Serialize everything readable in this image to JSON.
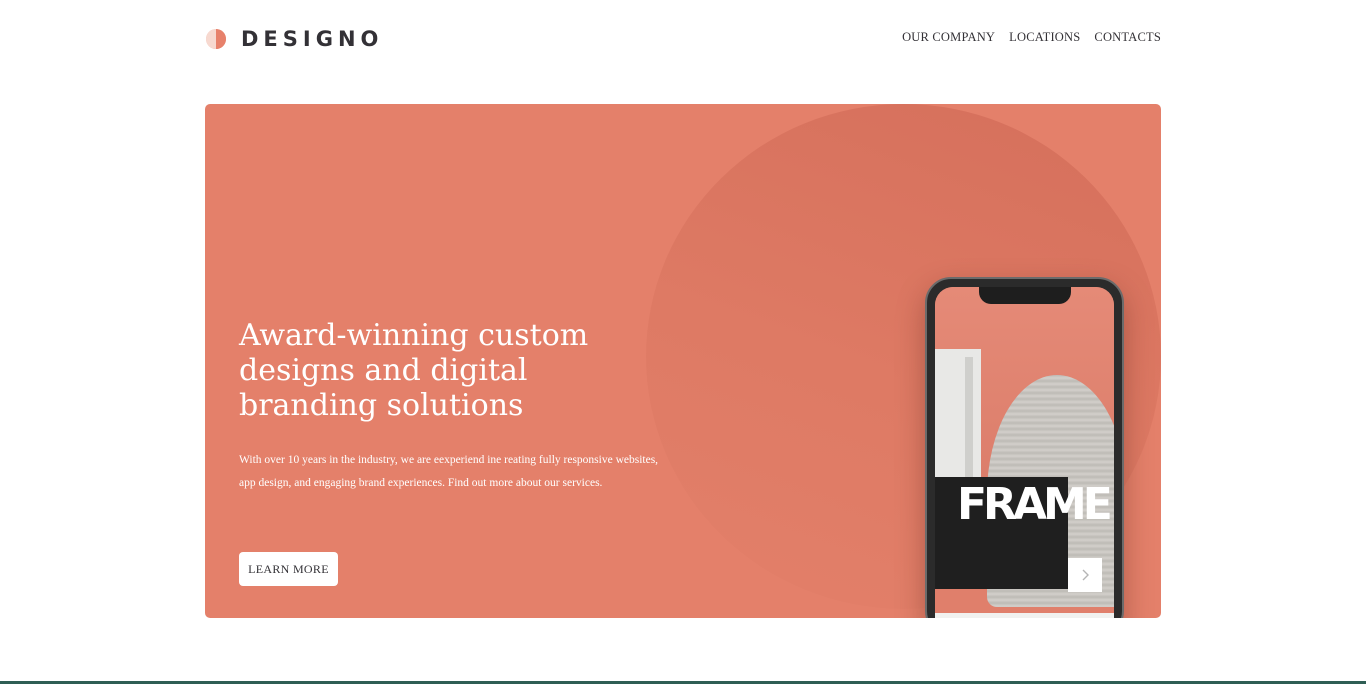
{
  "header": {
    "logo_text": "DESIGNO",
    "logo_icon": "half-circle-logo-icon",
    "nav": [
      {
        "label": "OUR COMPANY"
      },
      {
        "label": "LOCATIONS"
      },
      {
        "label": "CONTACTS"
      }
    ]
  },
  "hero": {
    "title": "Award-winning custom designs and digital branding solutions",
    "text": "With over 10 years in the industry, we are eexperiend ine reating fully responsive websites, app design, and engaging brand experiences. Find out more about our services.",
    "button_label": "LEARN MORE",
    "phone_screen": {
      "brand_text": "FRAME",
      "next_icon": "chevron-right-icon"
    }
  },
  "colors": {
    "accent": "#e4806a",
    "text": "#333136",
    "bottom_bar": "#2f5e54"
  }
}
